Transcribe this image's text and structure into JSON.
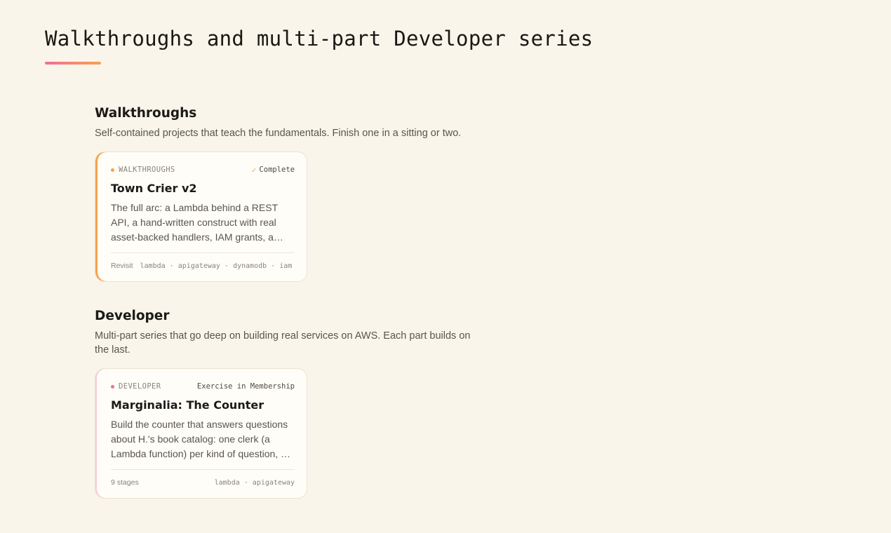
{
  "page": {
    "title": "Walkthroughs and multi-part Developer series"
  },
  "sections": [
    {
      "heading": "Walkthroughs",
      "description": "Self-contained projects that teach the fundamentals. Finish one in a sitting or two.",
      "cards": [
        {
          "tag": "WALKTHROUGHS",
          "status": "Complete",
          "status_icon": "check-icon",
          "title": "Town Crier v2",
          "description": "The full arc: a Lambda behind a REST API, a hand-written construct with real asset-backed handlers, IAM grants, a validated request model and tests.",
          "footer_left": "Revisit",
          "footer_tags": "lambda · apigateway · dynamodb · iam",
          "accent_color": "#f7a24a"
        }
      ]
    },
    {
      "heading": "Developer",
      "description": "Multi-part series that go deep on building real services on AWS. Each part builds on the last.",
      "cards": [
        {
          "tag": "DEVELOPER",
          "status": "Exercise in Membership",
          "title": "Marginalia: The Counter",
          "description": "Build the counter that answers questions about H.'s book catalog: one clerk (a Lambda function) per kind of question, all behind one API.",
          "footer_left": "9 stages",
          "footer_tags": "lambda · apigateway",
          "accent_color": "#f56d96"
        }
      ]
    }
  ]
}
